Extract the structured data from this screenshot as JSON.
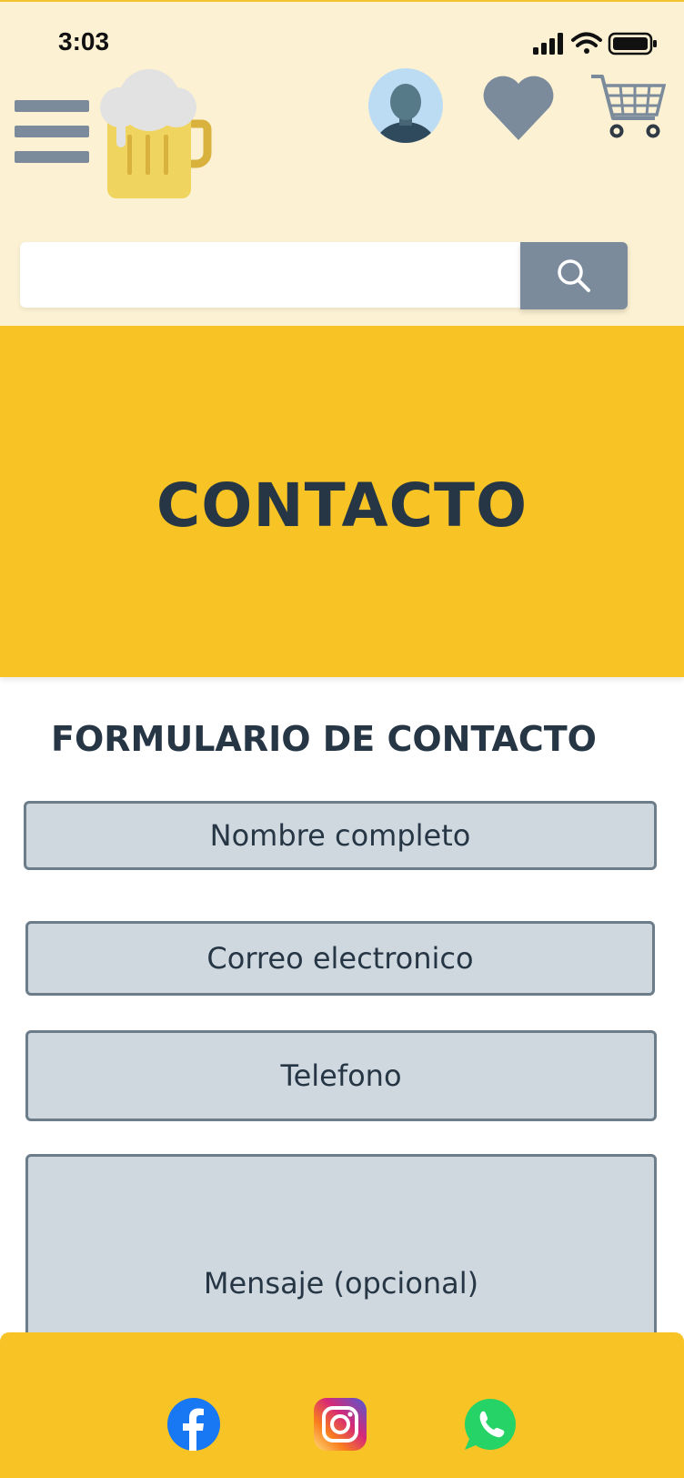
{
  "status_bar": {
    "time": "3:03",
    "icons": [
      "signal-icon",
      "wifi-icon",
      "battery-icon"
    ]
  },
  "header": {
    "menu_icon": "hamburger-menu-icon",
    "logo_icon": "beer-mug-logo-icon",
    "actions": [
      "user-avatar-icon",
      "heart-icon",
      "shopping-cart-icon"
    ],
    "search": {
      "value": "",
      "placeholder": "",
      "button_icon": "search-icon"
    }
  },
  "hero": {
    "title": "CONTACTO"
  },
  "form": {
    "title": "FORMULARIO DE CONTACTO",
    "fields": {
      "name": "Nombre completo",
      "email": "Correo electronico",
      "phone": "Telefono",
      "message": "Mensaje (opcional)"
    }
  },
  "footer": {
    "social": [
      "facebook-icon",
      "instagram-icon",
      "whatsapp-icon"
    ]
  },
  "colors": {
    "header_bg": "#fcf1d3",
    "accent_yellow": "#f7c325",
    "slate": "#7b8b9c",
    "dark_text": "#263645",
    "field_bg": "#cfd8df"
  }
}
